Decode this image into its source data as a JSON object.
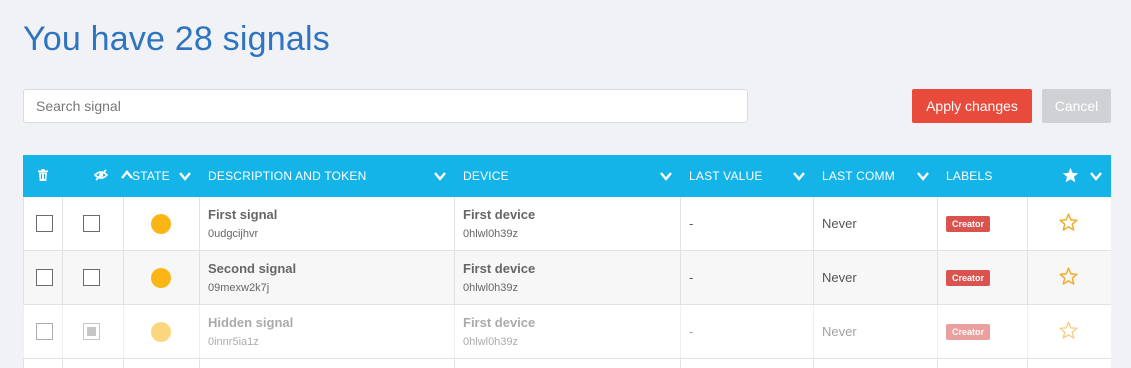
{
  "header": {
    "title": "You have 28 signals"
  },
  "search": {
    "placeholder": "Search signal"
  },
  "actions": {
    "apply_label": "Apply changes",
    "cancel_label": "Cancel"
  },
  "table": {
    "columns": {
      "state": "STATE",
      "description": "DESCRIPTION AND TOKEN",
      "device": "DEVICE",
      "last_value": "LAST VALUE",
      "last_comm": "LAST COMM",
      "labels": "LABELS"
    },
    "rows": [
      {
        "name": "First signal",
        "token": "0udgcijhvr",
        "device": "First device",
        "device_token": "0hlwl0h39z",
        "last_value": "-",
        "last_comm": "Never",
        "label": "Creator",
        "selected": false,
        "hidden": false,
        "state_color": "#fbb616"
      },
      {
        "name": "Second signal",
        "token": "09mexw2k7j",
        "device": "First device",
        "device_token": "0hlwl0h39z",
        "last_value": "-",
        "last_comm": "Never",
        "label": "Creator",
        "selected": false,
        "hidden": false,
        "state_color": "#fbb616"
      },
      {
        "name": "Hidden signal",
        "token": "0innr5ia1z",
        "device": "First device",
        "device_token": "0hlwl0h39z",
        "last_value": "-",
        "last_comm": "Never",
        "label": "Creator",
        "selected": false,
        "hidden": true,
        "state_color": "#fbb616"
      }
    ]
  },
  "colors": {
    "title": "#2f74c0",
    "header_bg": "#14b4e8",
    "apply": "#e84a3c",
    "cancel": "#d0d1d4",
    "badge": "#d9534f",
    "star": "#f0a92a"
  }
}
